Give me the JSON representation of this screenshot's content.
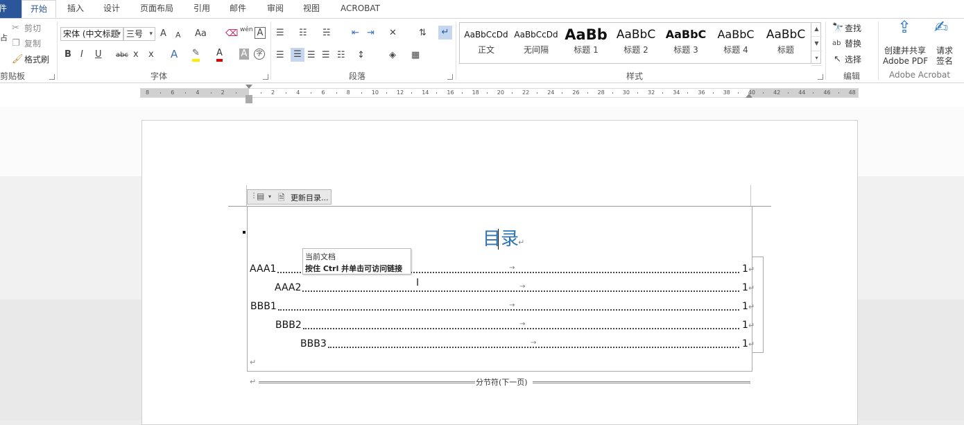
{
  "tabs": [
    "件",
    "开始",
    "插入",
    "设计",
    "页面布局",
    "引用",
    "邮件",
    "审阅",
    "视图",
    "ACROBAT"
  ],
  "clipboard": {
    "cut": "剪切",
    "copy": "复制",
    "painter": "格式刷",
    "label": "剪贴板",
    "paste_fragment": "占"
  },
  "font": {
    "name": "宋体 (中文标题",
    "size": "三号",
    "label": "字体",
    "grow": "A",
    "shrink": "A",
    "case": "Aa",
    "phonetic": "wén",
    "bold": "B",
    "italic": "I",
    "underline": "U",
    "strike": "abc",
    "sub": "x",
    "sup": "x",
    "effects": "A",
    "fontcolor": "A",
    "shade": "A",
    "enclose": "字"
  },
  "paragraph": {
    "label": "段落"
  },
  "styles": {
    "label": "样式",
    "items": [
      {
        "preview": "AaBbCcDd",
        "name": "正文"
      },
      {
        "preview": "AaBbCcDd",
        "name": "无间隔"
      },
      {
        "preview": "AaBb",
        "name": "标题 1"
      },
      {
        "preview": "AaBbC",
        "name": "标题 2"
      },
      {
        "preview": "AaBbC",
        "name": "标题 3"
      },
      {
        "preview": "AaBbC",
        "name": "标题 4"
      },
      {
        "preview": "AaBbC",
        "name": "标题"
      }
    ]
  },
  "editing": {
    "find": "查找",
    "replace": "替换",
    "select": "选择",
    "label": "编辑"
  },
  "acrobat": {
    "create_line1": "创建并共享",
    "create_line2": "Adobe PDF",
    "sign_line1": "请求",
    "sign_line2": "签名",
    "label": "Adobe Acrobat"
  },
  "ruler": {
    "numbers": [
      "8",
      "6",
      "4",
      "2",
      "",
      "2",
      "4",
      "6",
      "8",
      "10",
      "12",
      "14",
      "16",
      "18",
      "20",
      "22",
      "24",
      "26",
      "28",
      "30",
      "32",
      "34",
      "36",
      "38",
      "40",
      "42",
      "44",
      "46",
      "48"
    ]
  },
  "toc_control": {
    "update": "更新目录..."
  },
  "document": {
    "title": "目录",
    "tooltip_line1": "当前文档",
    "tooltip_line2": "按住 Ctrl 并单击可访问链接",
    "entries": [
      {
        "text": "AAA1",
        "page": "1"
      },
      {
        "text": "AAA2",
        "page": "1"
      },
      {
        "text": "BBB1",
        "page": "1"
      },
      {
        "text": "BBB2",
        "page": "1"
      },
      {
        "text": "BBB3",
        "page": "1"
      }
    ],
    "section_break": "分节符(下一页)",
    "pilcrow": "↵",
    "tab_arrow": "→"
  },
  "colors": {
    "file_tab": "#2b579a",
    "accent": "#2b579a",
    "title_blue": "#2e74b5"
  }
}
